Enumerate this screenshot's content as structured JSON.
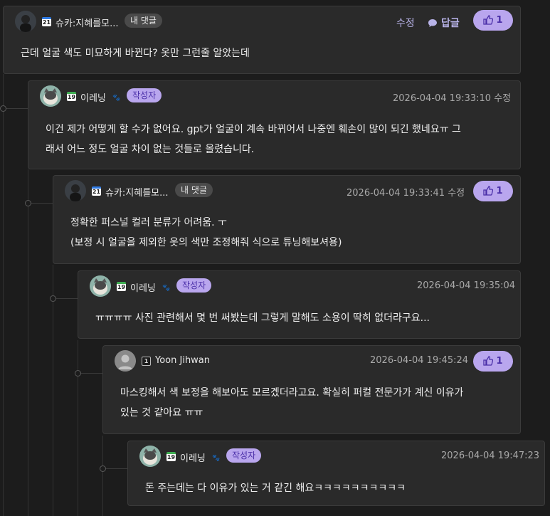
{
  "labels": {
    "my_comment": "내 댓글",
    "author": "작성자",
    "edit": "수정",
    "reply": "답글"
  },
  "comments": [
    {
      "nickname": "슈카:지혜를모...",
      "level": "21",
      "timestamp": "",
      "likes": "1",
      "text": [
        "근데 얼굴 색도 미묘하게 바뀐다? 옷만 그런줄 알았는데"
      ]
    },
    {
      "nickname": "이레닝",
      "level": "19",
      "timestamp": "2026-04-04 19:33:10",
      "likes": "",
      "text": [
        "이건 제가 어떻게 할 수가 없어요. gpt가 얼굴이 계속 바뀌어서 나중엔 훼손이 많이 되긴 했네요ㅠ 그",
        "래서 어느 정도 얼굴 차이 없는 것들로 올렸습니다."
      ]
    },
    {
      "nickname": "슈카:지혜를모...",
      "level": "21",
      "timestamp": "2026-04-04 19:33:41",
      "likes": "1",
      "text": [
        "정확한 퍼스널 컬러 분류가 어려움. ㅜ",
        "(보정 시 얼굴을 제외한 옷의 색만 조정해줘 식으로 튜닝해보셔용)"
      ]
    },
    {
      "nickname": "이레닝",
      "level": "19",
      "timestamp": "2026-04-04 19:35:04",
      "likes": "",
      "text": [
        "ㅠㅠㅠㅠ 사진 관련해서 몇 번 써봤는데 그렇게 말해도 소용이 딱히 없더라구요..."
      ]
    },
    {
      "nickname": "Yoon Jihwan",
      "level": "1",
      "timestamp": "2026-04-04 19:45:24",
      "likes": "1",
      "text": [
        "마스킹해서 색 보정을 해보아도 모르겠더라고요. 확실히 퍼컬 전문가가 계신 이유가",
        "있는 것 같아요 ㅠㅠ"
      ]
    },
    {
      "nickname": "이레닝",
      "level": "19",
      "timestamp": "2026-04-04 19:47:23",
      "likes": "",
      "text": [
        "돈 주는데는 다 이유가 있는 거 같긴 해요ㅋㅋㅋㅋㅋㅋㅋㅋㅋㅋ"
      ]
    }
  ]
}
